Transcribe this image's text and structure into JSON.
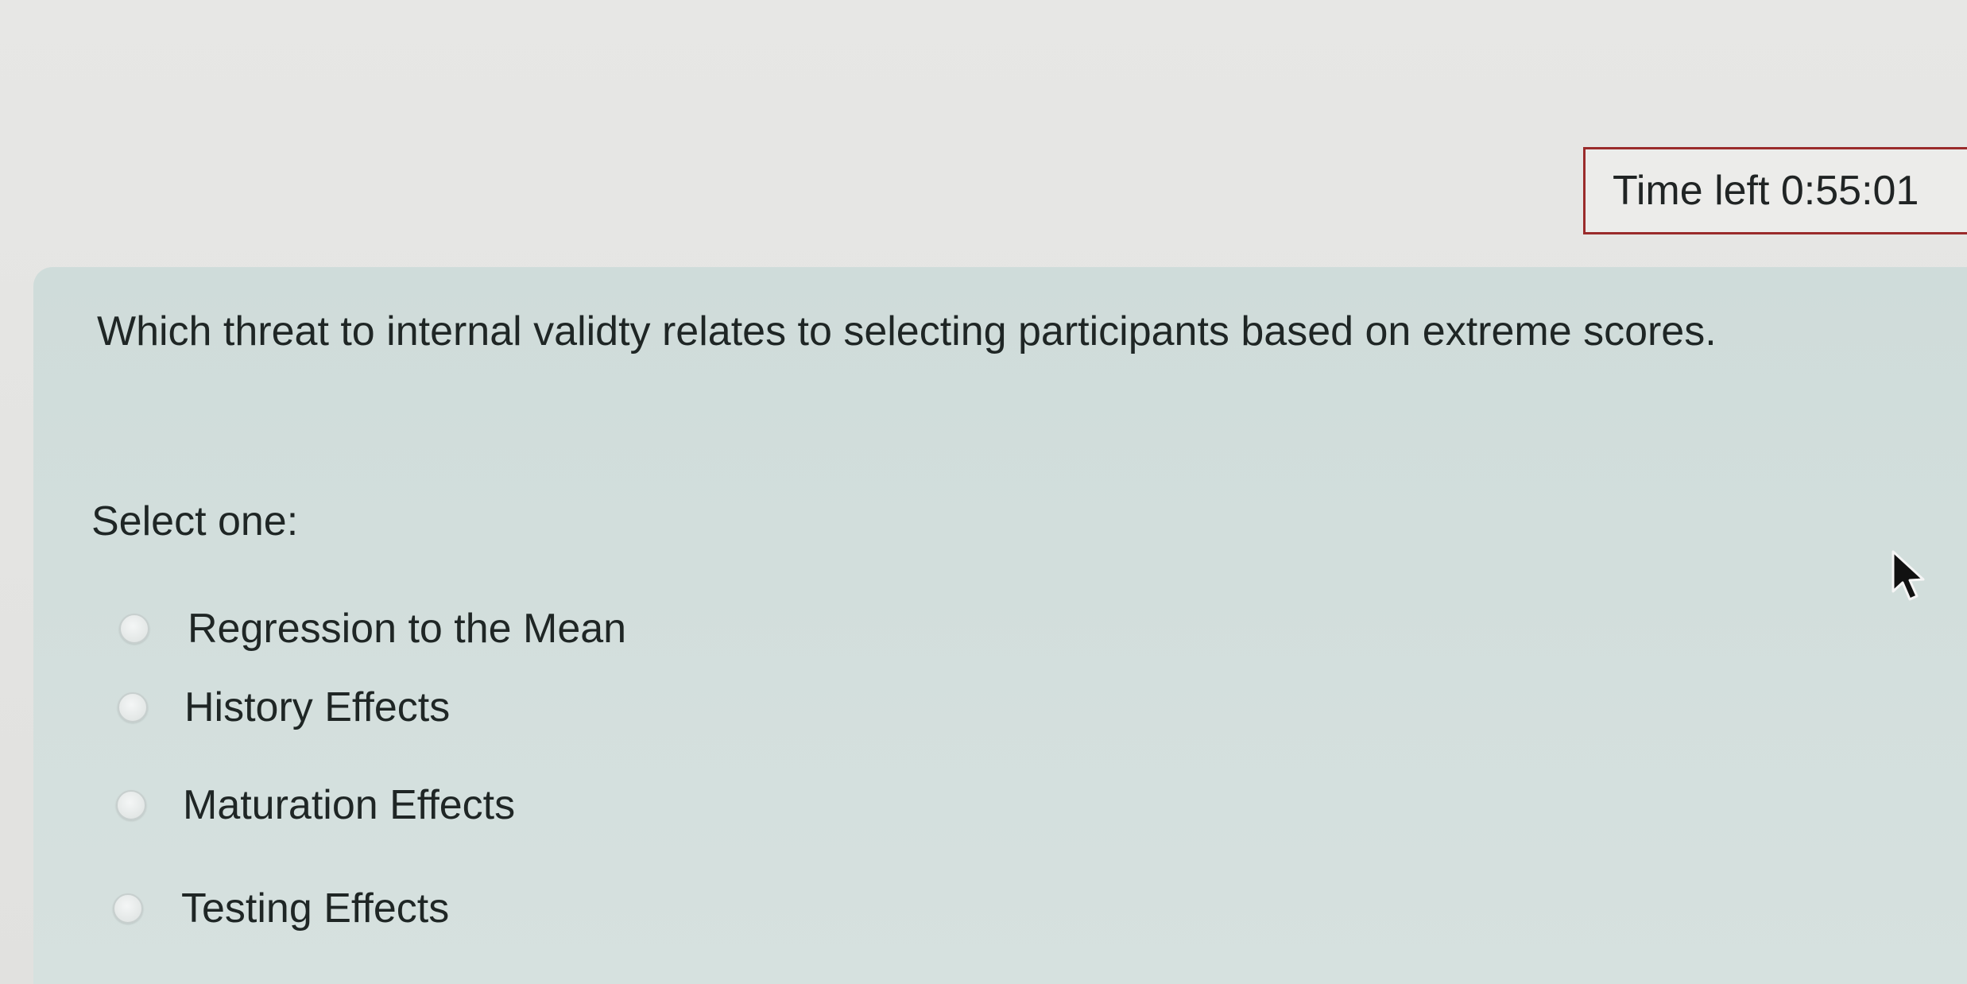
{
  "timer": {
    "label": "Time left 0:55:01"
  },
  "question": {
    "text": "Which threat to internal validty relates to selecting participants based on extreme scores.",
    "select_label": "Select one:",
    "options": [
      {
        "label": "Regression to the Mean",
        "selected": false
      },
      {
        "label": "History Effects",
        "selected": false
      },
      {
        "label": "Maturation Effects",
        "selected": false
      },
      {
        "label": "Testing Effects",
        "selected": false
      }
    ]
  },
  "colors": {
    "timer_border": "#9a2b2b",
    "panel_background": "#d2dedc",
    "page_background": "#e4e4e2"
  },
  "icons": {
    "cursor": "mouse-pointer-icon",
    "radio": "radio-button-icon"
  }
}
